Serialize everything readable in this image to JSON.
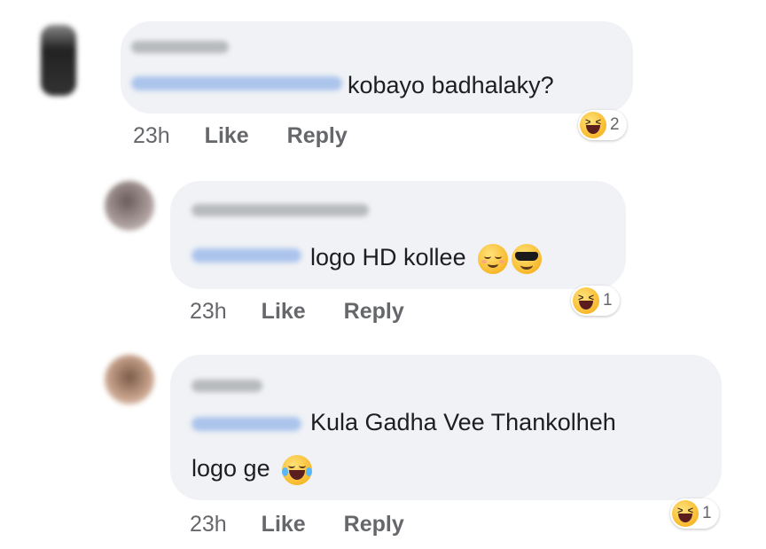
{
  "comments": [
    {
      "text": "kobayo badhalaky?",
      "time": "23h",
      "like": "Like",
      "reply": "Reply",
      "reaction_count": "2",
      "reaction_icon": "laughing-squint-icon"
    },
    {
      "text": "logo HD kollee",
      "time": "23h",
      "like": "Like",
      "reply": "Reply",
      "reaction_count": "1",
      "reaction_icon": "laughing-squint-icon",
      "inline_emojis": [
        "relieved-face-icon",
        "sunglasses-face-icon"
      ]
    },
    {
      "text_line1": "Kula Gadha Vee Thankolheh",
      "text_line2": "logo ge",
      "time": "23h",
      "like": "Like",
      "reply": "Reply",
      "reaction_count": "1",
      "reaction_icon": "laughing-squint-icon",
      "inline_emojis": [
        "tears-of-joy-icon"
      ]
    }
  ],
  "colors": {
    "bubble": "#f0f2f5",
    "meta_text": "#65676b",
    "mention_blur": "#7ea6e6"
  }
}
